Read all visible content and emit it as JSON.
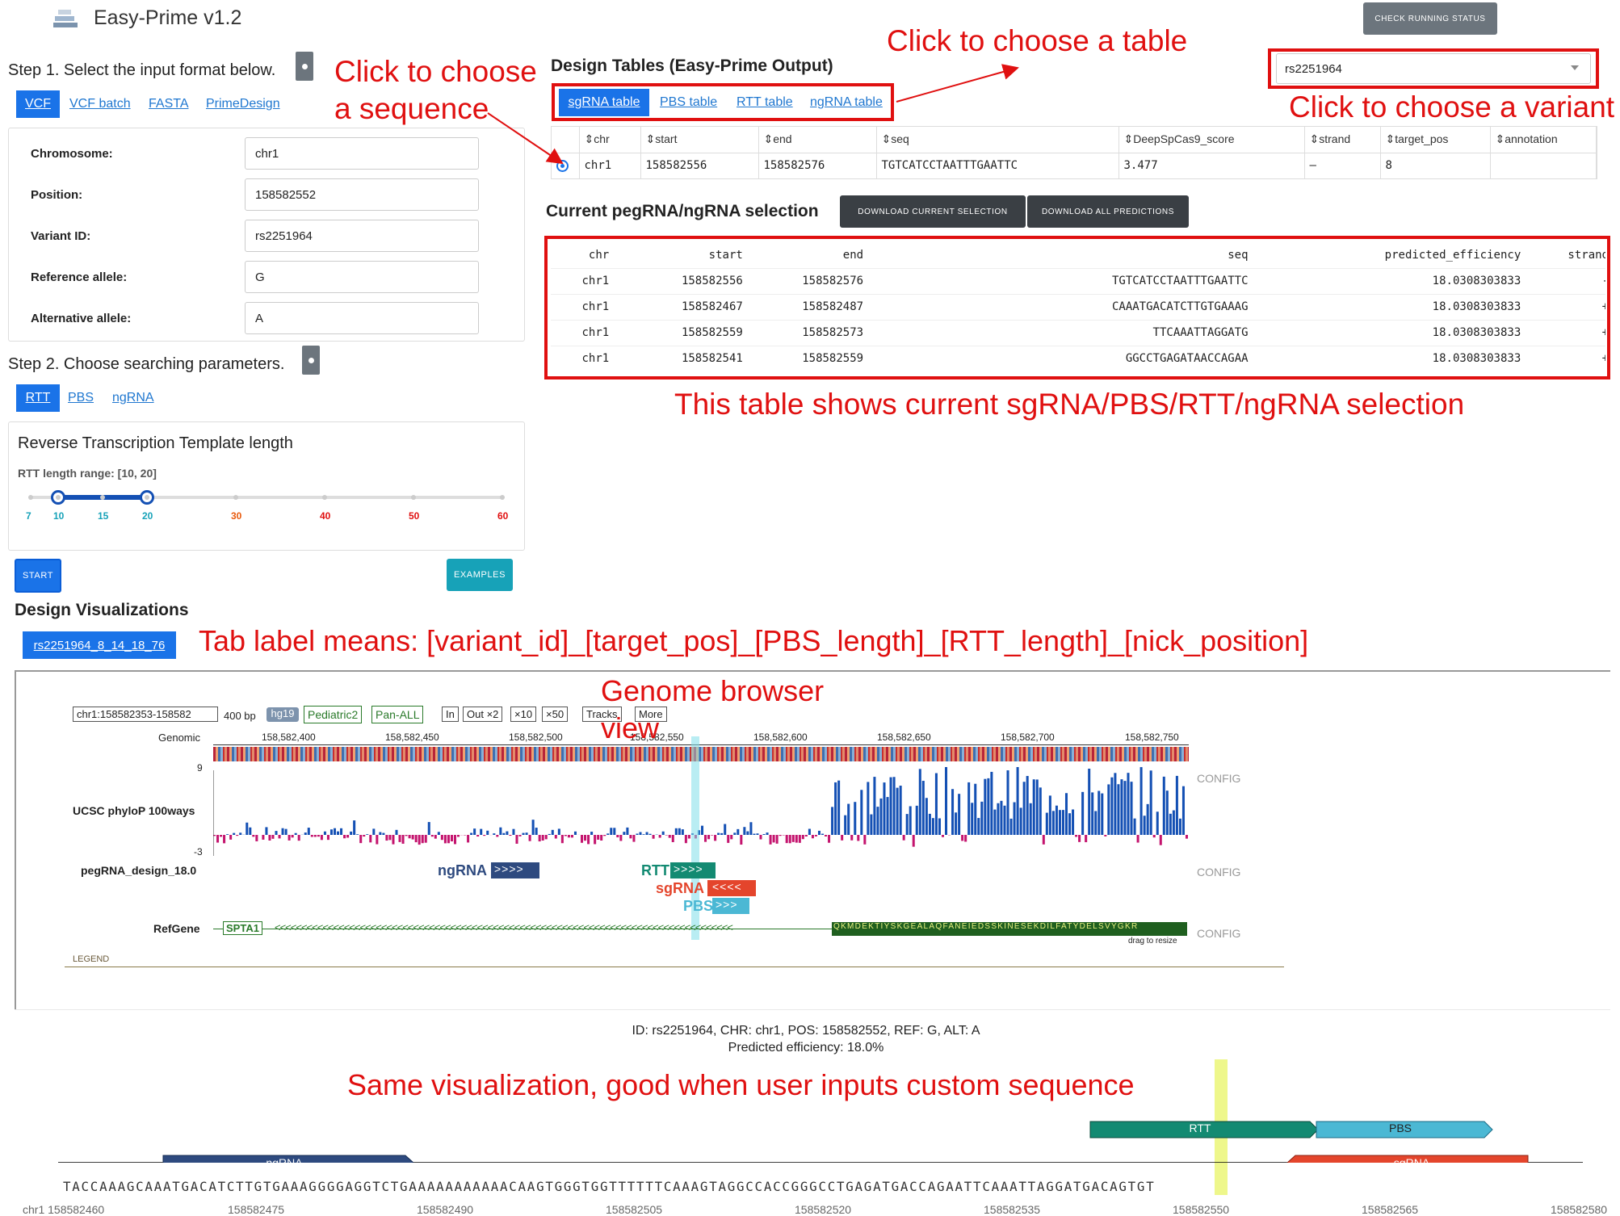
{
  "app": {
    "title": "Easy-Prime v1.2",
    "check_status": "CHECK RUNNING STATUS"
  },
  "step1": {
    "title": "Step 1. Select the input format below.",
    "info": "?",
    "tabs": [
      "VCF",
      "VCF batch",
      "FASTA",
      "PrimeDesign"
    ],
    "fields": [
      {
        "label": "Chromosome:",
        "value": "chr1"
      },
      {
        "label": "Position:",
        "value": "158582552"
      },
      {
        "label": "Variant ID:",
        "value": "rs2251964"
      },
      {
        "label": "Reference allele:",
        "value": "G"
      },
      {
        "label": "Alternative allele:",
        "value": "A"
      }
    ]
  },
  "step2": {
    "title": "Step 2. Choose searching parameters.",
    "info": "?",
    "tabs": [
      "RTT",
      "PBS",
      "ngRNA"
    ],
    "panel_title": "Reverse Transcription Template length",
    "range_label": "RTT length range: [10, 20]",
    "range": [
      10,
      20
    ],
    "ticks": [
      {
        "label": "7",
        "color": "#17a2b8"
      },
      {
        "label": "10",
        "color": "#17a2b8"
      },
      {
        "label": "15",
        "color": "#17a2b8"
      },
      {
        "label": "20",
        "color": "#17a2b8"
      },
      {
        "label": "30",
        "color": "#e8590c"
      },
      {
        "label": "40",
        "color": "#e01010"
      },
      {
        "label": "50",
        "color": "#e01010"
      },
      {
        "label": "60",
        "color": "#e01010"
      }
    ]
  },
  "buttons": {
    "start": "START",
    "examples": "EXAMPLES",
    "download_current": "DOWNLOAD CURRENT SELECTION",
    "download_all": "DOWNLOAD ALL PREDICTIONS"
  },
  "design_tables": {
    "title": "Design Tables (Easy-Prime Output)",
    "variant_select": "rs2251964",
    "tabs": [
      "sgRNA table",
      "PBS table",
      "RTT table",
      "ngRNA table"
    ],
    "columns": [
      "chr",
      "start",
      "end",
      "seq",
      "DeepSpCas9_score",
      "strand",
      "target_pos",
      "annotation"
    ],
    "row": [
      "chr1",
      "158582556",
      "158582576",
      "TGTCATCCTAATTTGAATTC",
      "3.477",
      "–",
      "8",
      ""
    ]
  },
  "current": {
    "title": "Current pegRNA/ngRNA selection",
    "columns": [
      "chr",
      "start",
      "end",
      "seq",
      "predicted_efficiency",
      "strand"
    ],
    "rows": [
      [
        "chr1",
        "158582556",
        "158582576",
        "TGTCATCCTAATTTGAATTC",
        "18.0308303833",
        "-"
      ],
      [
        "chr1",
        "158582467",
        "158582487",
        "CAAATGACATCTTGTGAAAG",
        "18.0308303833",
        "+"
      ],
      [
        "chr1",
        "158582559",
        "158582573",
        "TTCAAATTAGGATG",
        "18.0308303833",
        "+"
      ],
      [
        "chr1",
        "158582541",
        "158582559",
        "GGCCTGAGATAACCAGAA",
        "18.0308303833",
        "+"
      ]
    ]
  },
  "visualizations": {
    "title": "Design Visualizations",
    "tab_label": "rs2251964_8_14_18_76"
  },
  "browser": {
    "locus": "chr1:158582353-158582",
    "bp": "400 bp",
    "genome": "hg19",
    "tracks_btns": [
      "Pediatric2",
      "Pan-ALL"
    ],
    "zoom_btns": [
      "In",
      "Out ×2",
      "×10",
      "×50",
      "Tracks",
      "More"
    ],
    "genomic_label": "Genomic",
    "ruler": [
      "158,582,400",
      "158,582,450",
      "158,582,500",
      "158,582,550",
      "158,582,600",
      "158,582,650",
      "158,582,700",
      "158,582,750"
    ],
    "phylop_label": "UCSC phyloP 100ways",
    "phylop_max": "9",
    "phylop_min": "-3",
    "peg_label": "pegRNA_design_18.0",
    "refgene_label": "RefGene",
    "gene": "SPTA1",
    "aa": "QKMDEKTIYSKGEALAQFANEIEDSSKINESEKDILFATYDELSVYGKR",
    "drag": "drag to resize",
    "config": "CONFIG",
    "legend": "LEGEND",
    "features": {
      "ngrna": "ngRNA",
      "rtt": "RTT",
      "sgrna": "sgRNA",
      "pbs": "PBS"
    }
  },
  "summary": {
    "line1": "ID: rs2251964, CHR: chr1, POS: 158582552, REF: G, ALT: A",
    "line2": "Predicted efficiency: 18.0%"
  },
  "seqview": {
    "sequence": "TACCAAAGCAAATGACATCTTGTGAAAGGGGAGGTCTGAAAAAAAAAAACAAGTGGGTGGTTTTTTCAAAGTAGGCCACCGGGCCTGAGATGACCAGAATTCAAATTAGGATGACAGTGT",
    "ticks": [
      "chr1 158582460",
      "158582475",
      "158582490",
      "158582505",
      "158582520",
      "158582535",
      "158582550",
      "158582565",
      "158582580"
    ],
    "features": {
      "ngrna": "ngRNA",
      "rtt": "RTT",
      "pbs": "PBS",
      "sgrna": "sgRNA"
    }
  },
  "annotations": {
    "choose_seq": "Click to choose\na sequence",
    "choose_table": "Click to choose a table",
    "choose_variant": "Click to choose a variant",
    "table_shows": "This table shows current sgRNA/PBS/RTT/ngRNA selection",
    "tab_means": "Tab label means: [variant_id]_[target_pos]_[PBS_length]_[RTT_length]_[nick_position]",
    "genome_browser": "Genome browser\nview",
    "same_vis": "Same visualization, good when user inputs custom sequence"
  },
  "colors": {
    "red": "#e01010",
    "blue_link": "#1f77d0",
    "ngrna": "#2e4a7f",
    "rtt": "#138a72",
    "sgrna": "#e4452c",
    "pbs": "#4bb8d4",
    "phylop_pos": "#1450b4",
    "phylop_neg": "#c4146e"
  }
}
